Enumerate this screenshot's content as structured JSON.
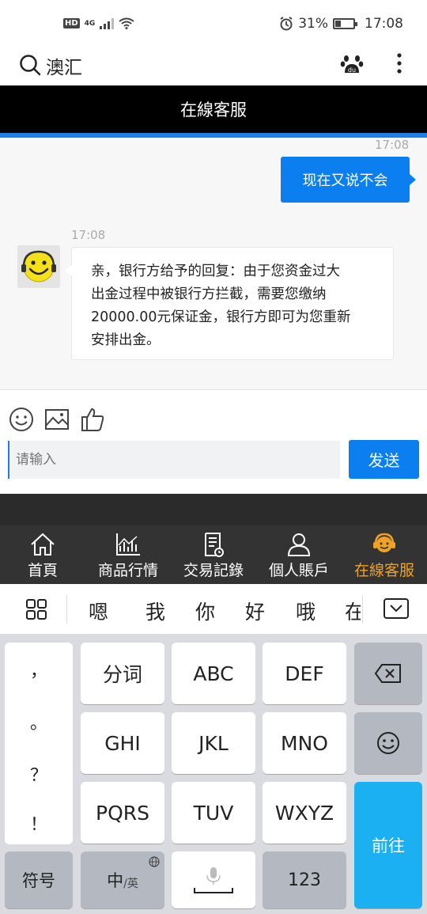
{
  "status_bar": {
    "hd": "HD",
    "network": "4G",
    "battery": "31%",
    "battery_level": 0.31,
    "time": "17:08"
  },
  "browser": {
    "search_text": "澳汇"
  },
  "chat": {
    "title": "在線客服",
    "messages": [
      {
        "direction": "out",
        "time": "17:08",
        "text": "现在又说不会"
      },
      {
        "direction": "in",
        "time": "17:08",
        "lines": [
          "亲，银行方给予的回复：由于您资金过大",
          "出金过程中被银行方拦截，需要您缴纳",
          "20000.00元保证金，银行方即可为您重新",
          "安排出金。"
        ]
      }
    ]
  },
  "composer": {
    "placeholder": "请输入",
    "send_label": "发送"
  },
  "nav": {
    "items": [
      {
        "label": "首頁",
        "icon": "home-icon"
      },
      {
        "label": "商品行情",
        "icon": "chart-icon"
      },
      {
        "label": "交易記錄",
        "icon": "records-icon"
      },
      {
        "label": "個人賬戶",
        "icon": "user-icon"
      },
      {
        "label": "在線客服",
        "icon": "support-icon",
        "active": true
      }
    ],
    "active_color": "#f0a225"
  },
  "keyboard": {
    "candidates": [
      "嗯",
      "我",
      "你",
      "好",
      "哦",
      "在"
    ],
    "punct": [
      "，",
      "。",
      "？",
      "！"
    ],
    "keys": {
      "segment": "分词",
      "abc": "ABC",
      "def": "DEF",
      "ghi": "GHI",
      "jkl": "JKL",
      "mno": "MNO",
      "pqrs": "PQRS",
      "tuv": "TUV",
      "wxyz": "WXYZ",
      "symbols": "符号",
      "lang_main": "中",
      "lang_sub": "/英",
      "numbers": "123",
      "go": "前往"
    }
  },
  "colors": {
    "accent": "#0b7ff0",
    "header_bg": "#000000",
    "keyboard_action": "#1ab0f2"
  }
}
